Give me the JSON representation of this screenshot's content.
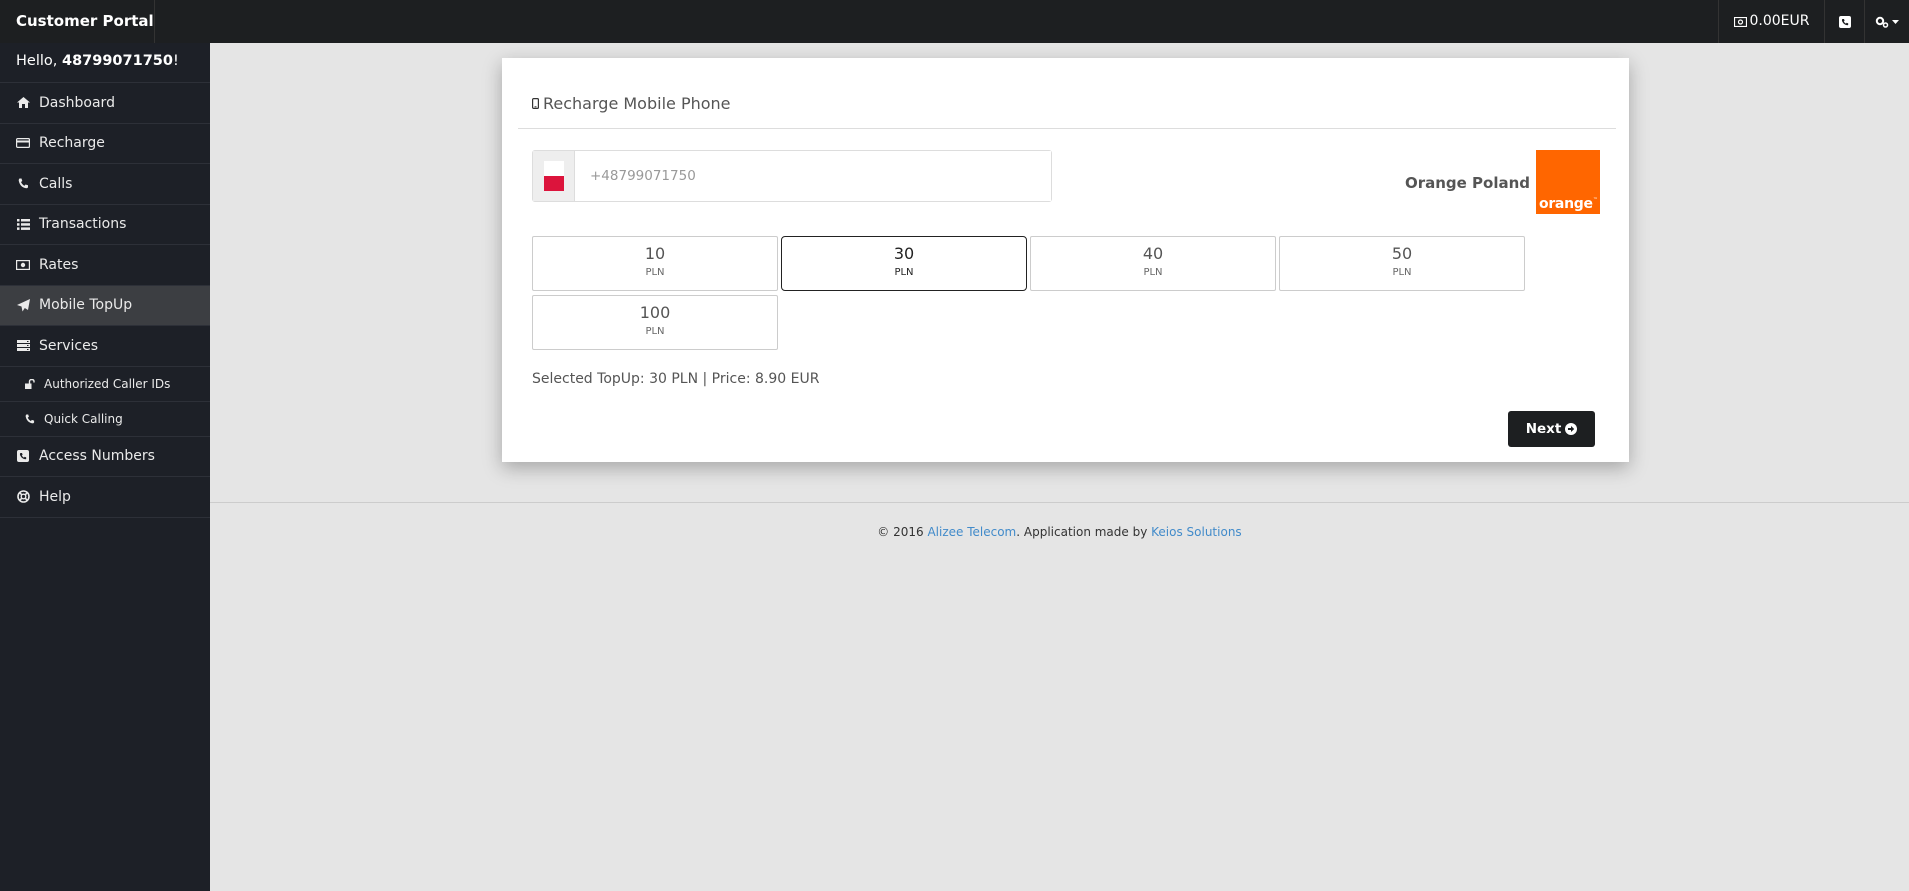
{
  "header": {
    "brand": "Customer Portal",
    "balance": "0.00EUR"
  },
  "sidebar": {
    "greeting_prefix": "Hello, ",
    "username": "48799071750",
    "greeting_suffix": "!",
    "items": [
      {
        "label": "Dashboard",
        "icon": "home-icon"
      },
      {
        "label": "Recharge",
        "icon": "credit-card-icon"
      },
      {
        "label": "Calls",
        "icon": "phone-icon"
      },
      {
        "label": "Transactions",
        "icon": "list-icon"
      },
      {
        "label": "Rates",
        "icon": "money-icon"
      },
      {
        "label": "Mobile TopUp",
        "icon": "paper-plane-icon",
        "active": true
      },
      {
        "label": "Services",
        "icon": "server-icon"
      },
      {
        "label": "Authorized Caller IDs",
        "icon": "unlock-icon",
        "sub": true
      },
      {
        "label": "Quick Calling",
        "icon": "phone-icon",
        "sub": true
      },
      {
        "label": "Access Numbers",
        "icon": "phone-square-icon"
      },
      {
        "label": "Help",
        "icon": "life-ring-icon"
      }
    ]
  },
  "card": {
    "title": "Recharge Mobile Phone",
    "phone_placeholder": "+48799071750",
    "operator_name": "Orange Poland",
    "operator_logo_text": "orange",
    "operator_logo_tm": "™",
    "amounts": [
      {
        "value": "10",
        "currency": "PLN",
        "selected": false
      },
      {
        "value": "30",
        "currency": "PLN",
        "selected": true
      },
      {
        "value": "40",
        "currency": "PLN",
        "selected": false
      },
      {
        "value": "50",
        "currency": "PLN",
        "selected": false
      },
      {
        "value": "100",
        "currency": "PLN",
        "selected": false
      }
    ],
    "summary": "Selected TopUp: 30 PLN | Price: 8.90 EUR",
    "next_label": "Next"
  },
  "footer": {
    "copyright": "© 2016 ",
    "company": "Alizee Telecom",
    "middle": ". Application made by ",
    "maker": "Keios Solutions"
  },
  "colors": {
    "topbar": "#1d1f21",
    "sidebar": "#1d2027",
    "active_item": "#3c3e42",
    "operator_brand": "#ff6600",
    "link": "#428bca"
  }
}
